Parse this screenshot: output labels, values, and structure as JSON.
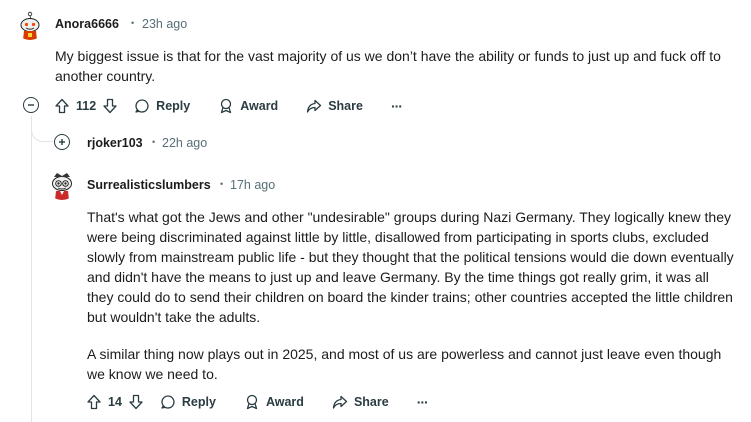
{
  "comments": [
    {
      "username": "Anora6666",
      "time": "23h ago",
      "body": "My biggest issue is that for the vast majority of us we don’t have the ability or funds to just up and fuck off to another country.",
      "score": "112",
      "reply_label": "Reply",
      "award_label": "Award",
      "share_label": "Share",
      "more_label": "···"
    },
    {
      "username": "rjoker103",
      "time": "22h ago"
    },
    {
      "username": "Surrealisticslumbers",
      "time": "17h ago",
      "paragraph1": "That's what got the Jews and other \"undesirable\" groups during Nazi Germany. They logically knew they were being discriminated against little by little, disallowed from participating in sports clubs, excluded slowly from mainstream public life - but they thought that the political tensions would die down eventually and didn't have the means to just up and leave Germany. By the time things got really grim, it was all they could do to send their children on board the kinder trains; other countries accepted the little children but wouldn't take the adults.",
      "paragraph2": "A similar thing now plays out in 2025, and most of us are powerless and cannot just leave even though we know we need to.",
      "score": "14",
      "reply_label": "Reply",
      "award_label": "Award",
      "share_label": "Share",
      "more_label": "···"
    }
  ],
  "separator": "•",
  "colors": {
    "meta": "#576f76",
    "action": "#2a3c42",
    "thread_line": "#e0e4e6"
  }
}
